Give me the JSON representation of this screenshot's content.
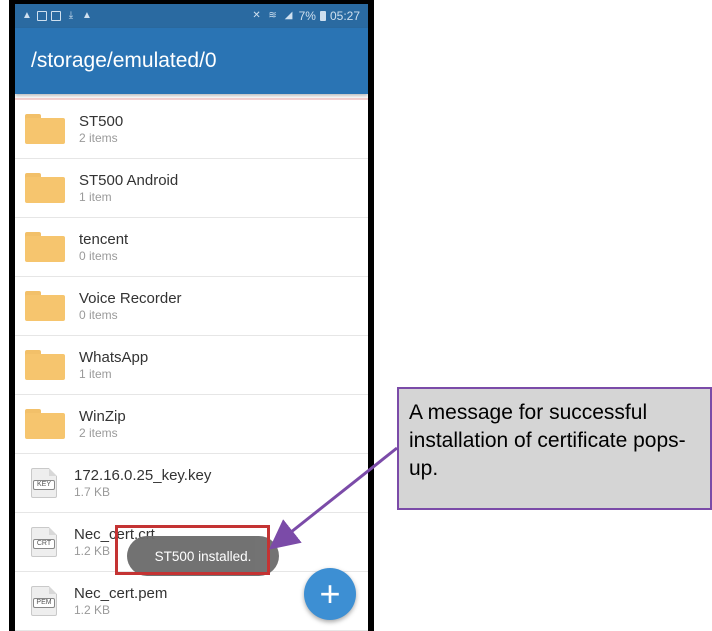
{
  "status_bar": {
    "left_icons": [
      "warning-icon",
      "image-icon",
      "message-icon",
      "download-icon",
      "warning-icon"
    ],
    "battery": "7%",
    "time": "05:27"
  },
  "app_bar": {
    "title": "/storage/emulated/0"
  },
  "files": [
    {
      "type": "folder",
      "name": "ST500",
      "detail": "2 items"
    },
    {
      "type": "folder",
      "name": "ST500 Android",
      "detail": "1 item"
    },
    {
      "type": "folder",
      "name": "tencent",
      "detail": "0 items"
    },
    {
      "type": "folder",
      "name": "Voice Recorder",
      "detail": "0 items"
    },
    {
      "type": "folder",
      "name": "WhatsApp",
      "detail": "1 item"
    },
    {
      "type": "folder",
      "name": "WinZip",
      "detail": "2 items"
    },
    {
      "type": "file",
      "ext": "KEY",
      "name": "172.16.0.25_key.key",
      "detail": "1.7 KB"
    },
    {
      "type": "file",
      "ext": "CRT",
      "name": "Nec_cert.crt",
      "detail": "1.2 KB"
    },
    {
      "type": "file",
      "ext": "PEM",
      "name": "Nec_cert.pem",
      "detail": "1.2 KB"
    }
  ],
  "toast": {
    "message": "ST500 installed."
  },
  "fab": {
    "label": "+"
  },
  "annotation": {
    "text": "A message for successful installation of certificate pops-up.",
    "colors": {
      "box_border": "#c43333",
      "callout_border": "#7b4ba8",
      "callout_fill": "#d5d5d5",
      "arrow": "#7b4ba8"
    }
  },
  "colors": {
    "status_bar": "#2a6aa1",
    "app_bar": "#2a74b4",
    "folder": "#f6c56e",
    "fab": "#3d8fd3"
  }
}
